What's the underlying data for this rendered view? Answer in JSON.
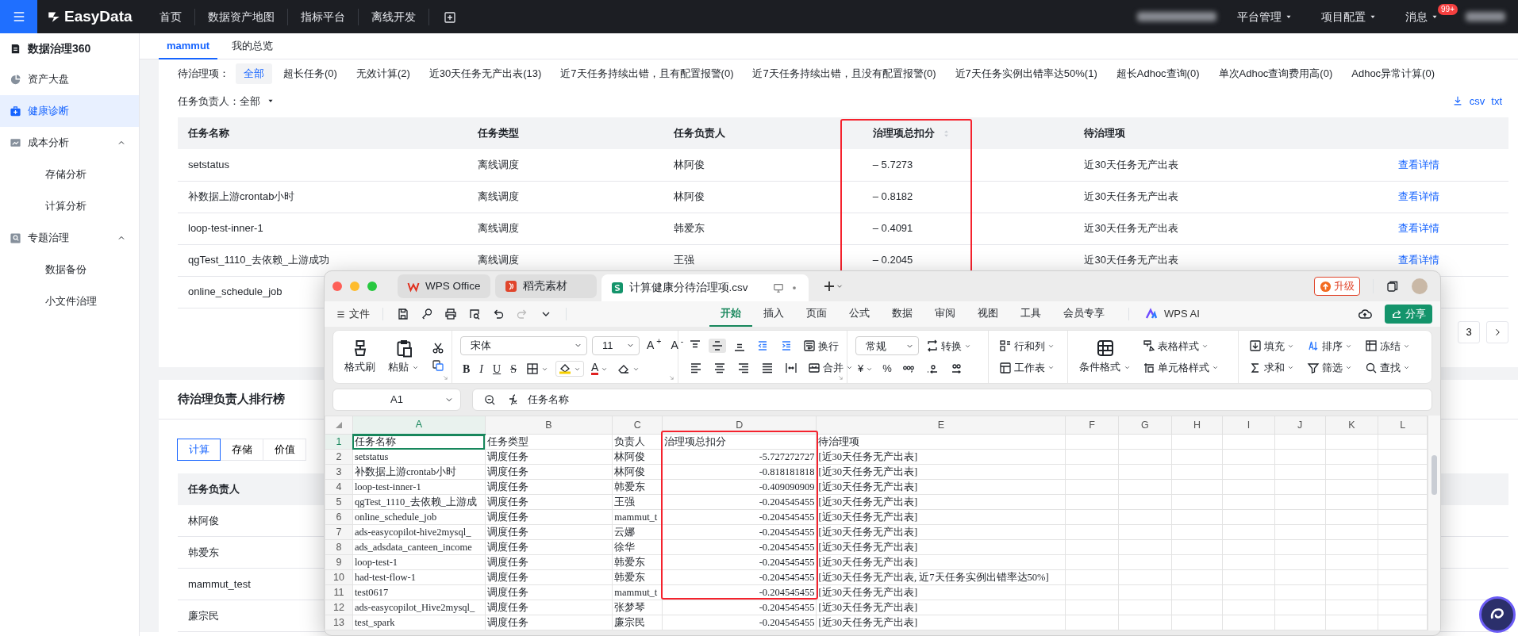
{
  "top_bar": {
    "logo": "EasyData",
    "nav": [
      "首页",
      "数据资产地图",
      "指标平台",
      "离线开发"
    ],
    "menus": [
      {
        "label": "平台管理"
      },
      {
        "label": "项目配置"
      },
      {
        "label": "消息",
        "badge": "99+"
      }
    ]
  },
  "sidebar": {
    "title": "数据治理360",
    "items": [
      {
        "label": "资产大盘",
        "selected": false
      },
      {
        "label": "健康诊断",
        "selected": true
      },
      {
        "label": "成本分析",
        "expanded": true,
        "children": [
          {
            "label": "存储分析",
            "selected": false
          },
          {
            "label": "计算分析",
            "selected": false
          }
        ]
      },
      {
        "label": "专题治理",
        "expanded": true,
        "children": [
          {
            "label": "数据备份",
            "selected": false
          },
          {
            "label": "小文件治理",
            "selected": false
          }
        ]
      }
    ]
  },
  "tabs": [
    {
      "label": "mammut",
      "selected": true
    },
    {
      "label": "我的总览",
      "selected": false
    }
  ],
  "filter": {
    "label": "待治理项：",
    "options": [
      {
        "label": "全部",
        "selected": true
      },
      {
        "label": "超长任务(0)",
        "selected": false
      },
      {
        "label": "无效计算(2)",
        "selected": false
      },
      {
        "label": "近30天任务无产出表(13)",
        "selected": false
      },
      {
        "label": "近7天任务持续出错，且有配置报警(0)",
        "selected": false
      },
      {
        "label": "近7天任务持续出错，且没有配置报警(0)",
        "selected": false
      },
      {
        "label": "近7天任务实例出错率达50%(1)",
        "selected": false
      },
      {
        "label": "超长Adhoc查询(0)",
        "selected": false
      },
      {
        "label": "单次Adhoc查询费用高(0)",
        "selected": false
      },
      {
        "label": "Adhoc异常计算(0)",
        "selected": false
      }
    ],
    "owner_label": "任务负责人：",
    "owner_value": "全部"
  },
  "downloads": [
    "csv",
    "txt"
  ],
  "task_table": {
    "columns": [
      {
        "label": "任务名称",
        "sortable": false
      },
      {
        "label": "任务类型",
        "sortable": false
      },
      {
        "label": "任务负责人",
        "sortable": false
      },
      {
        "label": "治理项总扣分",
        "sortable": true
      },
      {
        "label": "待治理项",
        "sortable": false
      }
    ],
    "rows": [
      {
        "name": "setstatus",
        "type": "离线调度",
        "owner": "林阿俊",
        "score": "– 5.7273",
        "issue": "近30天任务无产出表",
        "action": "查看详情"
      },
      {
        "name": "补数据上游crontab小时",
        "type": "离线调度",
        "owner": "林阿俊",
        "score": "– 0.8182",
        "issue": "近30天任务无产出表",
        "action": "查看详情"
      },
      {
        "name": "loop-test-inner-1",
        "type": "离线调度",
        "owner": "韩爱东",
        "score": "– 0.4091",
        "issue": "近30天任务无产出表",
        "action": "查看详情"
      },
      {
        "name": "qgTest_1110_去依赖_上游成功",
        "type": "离线调度",
        "owner": "王强",
        "score": "– 0.2045",
        "issue": "近30天任务无产出表",
        "action": "查看详情"
      },
      {
        "name": "online_schedule_job"
      }
    ]
  },
  "pagination": {
    "page": "3"
  },
  "ranking": {
    "title": "待治理负责人排行榜",
    "tabs": [
      {
        "label": "计算",
        "selected": true
      },
      {
        "label": "存储",
        "selected": false
      },
      {
        "label": "价值",
        "selected": false
      }
    ],
    "column": "任务负责人",
    "rows": [
      "林阿俊",
      "韩爱东",
      "mammut_test",
      "廉宗民"
    ]
  },
  "wps": {
    "tabs": [
      {
        "label": "WPS Office",
        "selected": false
      },
      {
        "label": "稻壳素材",
        "selected": false
      },
      {
        "label": "计算健康分待治理项.csv",
        "selected": true
      }
    ],
    "upgrade": "升级",
    "file_menu": "文件",
    "menu": [
      {
        "label": "开始",
        "selected": true
      },
      {
        "label": "插入",
        "selected": false
      },
      {
        "label": "页面",
        "selected": false
      },
      {
        "label": "公式",
        "selected": false
      },
      {
        "label": "数据",
        "selected": false
      },
      {
        "label": "审阅",
        "selected": false
      },
      {
        "label": "视图",
        "selected": false
      },
      {
        "label": "工具",
        "selected": false
      },
      {
        "label": "会员专享",
        "selected": false
      }
    ],
    "ai": "WPS AI",
    "share": "分享",
    "ribbon": {
      "format_painter": "格式刷",
      "paste": "粘贴",
      "font": "宋体",
      "size": "11",
      "grow": "A$^{+}$",
      "shrink": "A$^{-}$",
      "styles": [
        "B",
        "I",
        "U",
        "S"
      ],
      "font_color": "A",
      "vertical_align": [
        {
          "selected": false
        },
        {
          "selected": true
        },
        {
          "selected": false
        }
      ],
      "wrap": "换行",
      "merge": "合并",
      "number_format": "常规",
      "convert": "转换",
      "currency": "¥",
      "percent": "%",
      "rows_columns": "行和列",
      "worksheet": "工作表",
      "conditional": "条件格式",
      "table_style": "表格样式",
      "cell_style": "单元格样式",
      "editing": [
        "填充",
        "排序",
        "冻结",
        "求和",
        "筛选",
        "查找"
      ]
    },
    "name_box": "A1",
    "formula": "任务名称",
    "sheet": {
      "columns": [
        {
          "label": "A",
          "selected": true
        },
        {
          "label": "B",
          "selected": false
        },
        {
          "label": "C",
          "selected": false
        },
        {
          "label": "D",
          "selected": false
        },
        {
          "label": "E",
          "selected": false
        },
        {
          "label": "F",
          "selected": false
        },
        {
          "label": "G",
          "selected": false
        },
        {
          "label": "H",
          "selected": false
        },
        {
          "label": "I",
          "selected": false
        },
        {
          "label": "J",
          "selected": false
        },
        {
          "label": "K",
          "selected": false
        },
        {
          "label": "L",
          "selected": false
        }
      ],
      "rows": [
        {
          "number": "1",
          "selected": true,
          "cells": [
            "任务名称",
            "任务类型",
            "负责人",
            "治理项总扣分",
            "待治理项"
          ]
        },
        {
          "number": "2",
          "selected": false,
          "cells": [
            "setstatus",
            "调度任务",
            "林阿俊",
            "-5.727272727",
            "[近30天任务无产出表]"
          ]
        },
        {
          "number": "3",
          "selected": false,
          "cells": [
            "补数据上游crontab小时",
            "调度任务",
            "林阿俊",
            "-0.818181818",
            "[近30天任务无产出表]"
          ]
        },
        {
          "number": "4",
          "selected": false,
          "cells": [
            "loop-test-inner-1",
            "调度任务",
            "韩爱东",
            "-0.409090909",
            "[近30天任务无产出表]"
          ]
        },
        {
          "number": "5",
          "selected": false,
          "cells": [
            "qgTest_1110_去依赖_上游成",
            "调度任务",
            "王强",
            "-0.204545455",
            "[近30天任务无产出表]"
          ]
        },
        {
          "number": "6",
          "selected": false,
          "cells": [
            "online_schedule_job",
            "调度任务",
            "mammut_t",
            "-0.204545455",
            "[近30天任务无产出表]"
          ]
        },
        {
          "number": "7",
          "selected": false,
          "cells": [
            "ads-easycopilot-hive2mysql_",
            "调度任务",
            "云娜",
            "-0.204545455",
            "[近30天任务无产出表]"
          ]
        },
        {
          "number": "8",
          "selected": false,
          "cells": [
            "ads_adsdata_canteen_income",
            "调度任务",
            "徐华",
            "-0.204545455",
            "[近30天任务无产出表]"
          ]
        },
        {
          "number": "9",
          "selected": false,
          "cells": [
            "loop-test-1",
            "调度任务",
            "韩爱东",
            "-0.204545455",
            "[近30天任务无产出表]"
          ]
        },
        {
          "number": "10",
          "selected": false,
          "cells": [
            "had-test-flow-1",
            "调度任务",
            "韩爱东",
            "-0.204545455",
            "[近30天任务无产出表, 近7天任务实例出错率达50%]"
          ]
        },
        {
          "number": "11",
          "selected": false,
          "cells": [
            "test0617",
            "调度任务",
            "mammut_t",
            "-0.204545455",
            "[近30天任务无产出表]"
          ]
        },
        {
          "number": "12",
          "selected": false,
          "cells": [
            "ads-easycopilot_Hive2mysql_",
            "调度任务",
            "张梦琴",
            "-0.204545455",
            "[近30天任务无产出表]"
          ]
        },
        {
          "number": "13",
          "selected": false,
          "cells": [
            "test_spark",
            "调度任务",
            "廉宗民",
            "-0.204545455",
            "[近30天任务无产出表]"
          ]
        }
      ]
    }
  }
}
